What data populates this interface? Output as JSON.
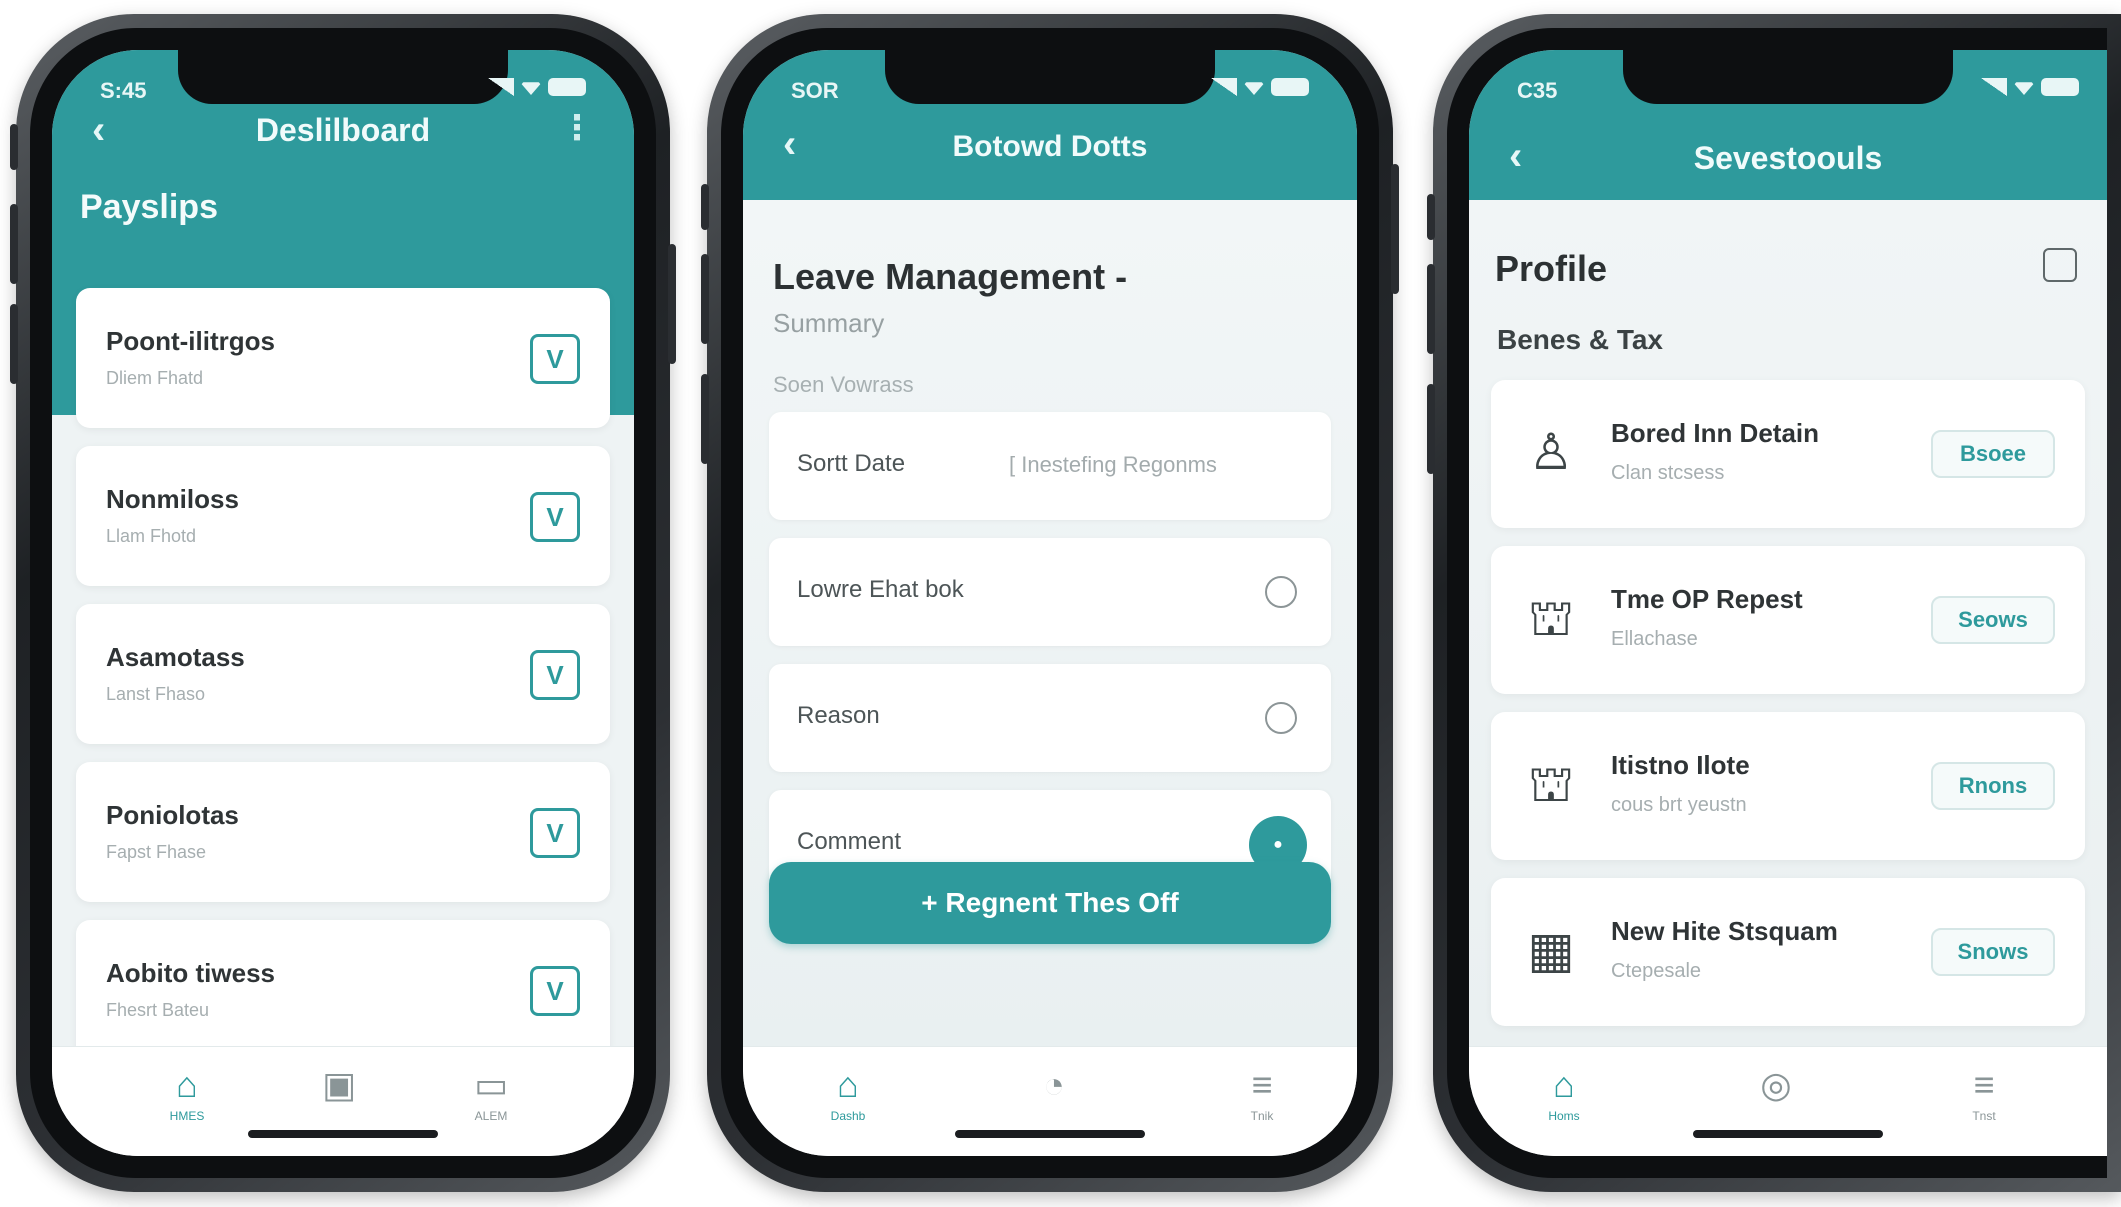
{
  "phones": {
    "dashboard": {
      "status_time": "S:45",
      "header_title": "Deslilboard",
      "back_glyph": "‹",
      "section_title": "Payslips",
      "items": [
        {
          "name": "Poont-ilitrgos",
          "sub": "Dliem Fhatd"
        },
        {
          "name": "Nonmiloss",
          "sub": "Llam Fhotd"
        },
        {
          "name": "Asamotass",
          "sub": "Lanst Fhaso"
        },
        {
          "name": "Poniolotas",
          "sub": "Fapst Fhase"
        },
        {
          "name": "Aobito tiwess",
          "sub": "Fhesrt Bateu"
        }
      ],
      "check_glyph": "V",
      "nav": [
        {
          "icon": "home-icon",
          "glyph": "⌂",
          "label": "HMES"
        },
        {
          "icon": "document-icon",
          "glyph": "▣",
          "label": ""
        },
        {
          "icon": "card-icon",
          "glyph": "▭",
          "label": "ALEM"
        }
      ]
    },
    "leave": {
      "status_time": "SOR",
      "header_title": "Botowd Dotts",
      "back_glyph": "‹",
      "title": "Leave Management -",
      "subtitle": "Summary",
      "section": "Soen Vowrass",
      "fields": [
        {
          "label": "Sortt Date",
          "value": "[ Inestefing Regonms"
        },
        {
          "label": "Lowre Ehat bok"
        },
        {
          "label": "Reason"
        },
        {
          "label": "Comment",
          "dot": "●"
        }
      ],
      "cta": "+ Regnent Thes Off",
      "nav": [
        {
          "icon": "home-icon",
          "glyph": "⌂",
          "label": "Dashb"
        },
        {
          "icon": "clock-icon",
          "glyph": "◔",
          "label": ""
        },
        {
          "icon": "list-icon",
          "glyph": "≡",
          "label": "Tnik"
        }
      ]
    },
    "profile": {
      "status_time": "C35",
      "header_title": "Sevestoouls",
      "back_glyph": "‹",
      "title": "Profile",
      "section": "Benes & Tax",
      "items": [
        {
          "icon": "person-icon",
          "glyph": "♙",
          "name": "Bored Inn Detain",
          "sub": "Clan stcsess",
          "btn": "Bsoee"
        },
        {
          "icon": "briefcase-icon",
          "glyph": "⛫",
          "name": "Tme OP Repest",
          "sub": "Ellachase",
          "btn": "Seows"
        },
        {
          "icon": "building-icon",
          "glyph": "⛫",
          "name": "Itistno Ilote",
          "sub": "cous brt yeustn",
          "btn": "Rnons"
        },
        {
          "icon": "grid-icon",
          "glyph": "▦",
          "name": "New Hite Stsquam",
          "sub": "Ctepesale",
          "btn": "Snows"
        }
      ],
      "nav": [
        {
          "icon": "home-icon",
          "glyph": "⌂",
          "label": "Homs"
        },
        {
          "icon": "gear-icon",
          "glyph": "◎",
          "label": ""
        },
        {
          "icon": "list-icon",
          "glyph": "≡",
          "label": "Tnst"
        }
      ]
    }
  },
  "colors": {
    "accent": "#2e9a9c",
    "background": "#eef3f4"
  }
}
